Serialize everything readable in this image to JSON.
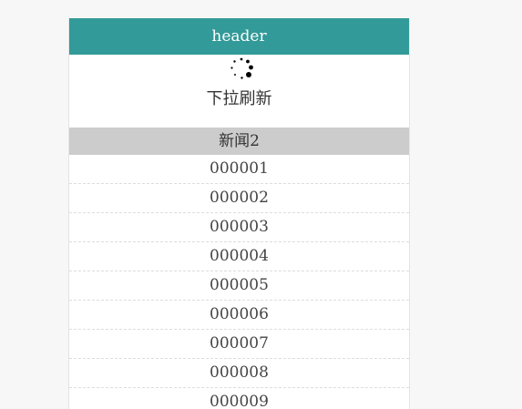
{
  "header": {
    "title": "header"
  },
  "pull": {
    "text": "下拉刷新",
    "spinner_icon": "loading-spinner-icon"
  },
  "section": {
    "title": "新闻2"
  },
  "list": {
    "items": [
      "000001",
      "000002",
      "000003",
      "000004",
      "000005",
      "000006",
      "000007",
      "000008",
      "000009"
    ]
  },
  "colors": {
    "header_bg": "#329a98",
    "section_bg": "#cccccc",
    "page_bg": "#f7f7f7"
  }
}
